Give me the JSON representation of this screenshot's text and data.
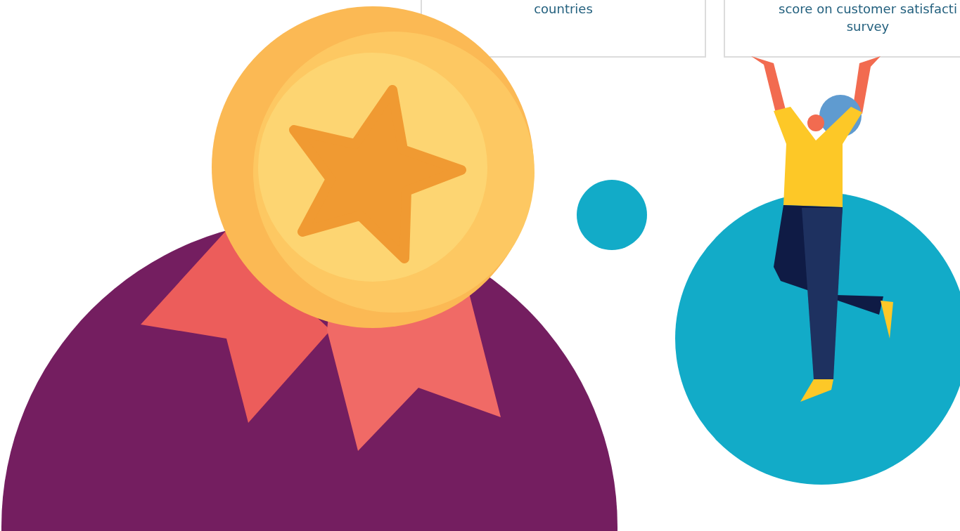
{
  "stat_cards": [
    {
      "lines": [
        "countries"
      ]
    },
    {
      "lines": [
        "score on customer satisfacti",
        "survey"
      ]
    }
  ]
}
